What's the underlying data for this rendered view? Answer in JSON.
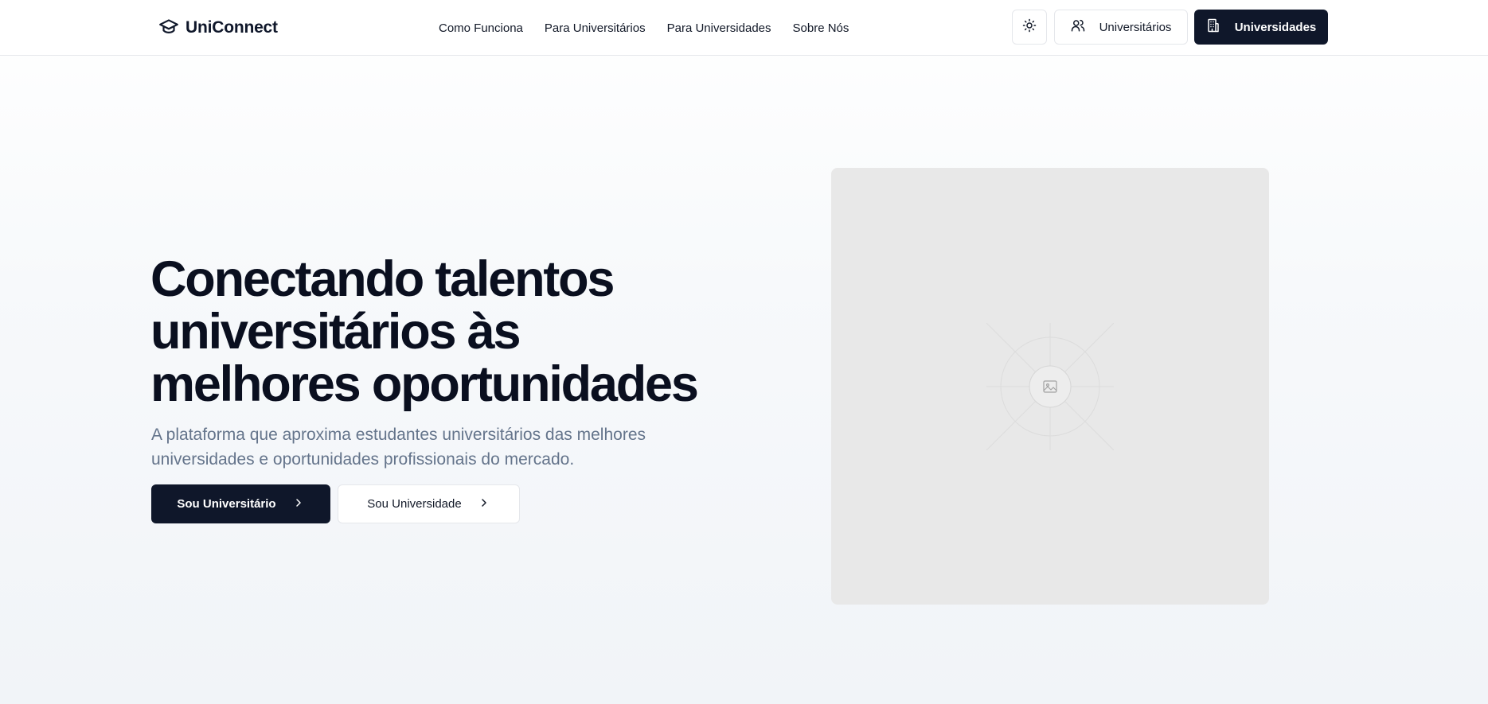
{
  "header": {
    "logo_text": "UniConnect",
    "logo_icon": "graduation-cap-icon",
    "nav": [
      {
        "label": "Como Funciona"
      },
      {
        "label": "Para Universitários"
      },
      {
        "label": "Para Universidades"
      },
      {
        "label": "Sobre Nós"
      }
    ],
    "theme_toggle_icon": "sun-icon",
    "students_button": {
      "label": "Universitários",
      "icon": "users-icon"
    },
    "universities_button": {
      "label": "Universidades",
      "icon": "building-icon"
    }
  },
  "hero": {
    "title_lines": [
      "Conectando talentos",
      "universitários às",
      "melhores oportunidades"
    ],
    "subtitle": "A plataforma que aproxima estudantes universitários das melhores universidades e oportunidades profissionais do mercado.",
    "primary_cta": {
      "label": "Sou Universitário",
      "icon": "chevron-right-icon"
    },
    "secondary_cta": {
      "label": "Sou Universidade",
      "icon": "chevron-right-icon"
    },
    "image_placeholder_icon": "image-icon"
  },
  "colors": {
    "primary": "#0f172a",
    "muted_text": "#64748b",
    "border": "#e5e7eb",
    "placeholder_bg": "#e8e8e8"
  }
}
